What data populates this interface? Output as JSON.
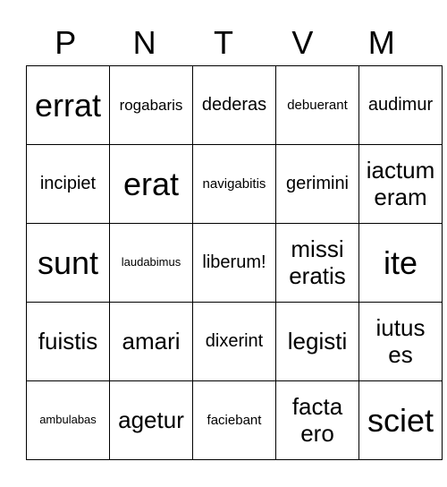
{
  "header": [
    "P",
    "N",
    "T",
    "V",
    "M"
  ],
  "rows": [
    [
      "errat",
      "rogabaris",
      "dederas",
      "debuerant",
      "audimur"
    ],
    [
      "incipiet",
      "erat",
      "navigabitis",
      "gerimini",
      "iactum eram"
    ],
    [
      "sunt",
      "laudabimus",
      "liberum!",
      "missi eratis",
      "ite"
    ],
    [
      "fuistis",
      "amari",
      "dixerint",
      "legisti",
      "iutus es"
    ],
    [
      "ambulabas",
      "agetur",
      "faciebant",
      "facta ero",
      "sciet"
    ]
  ]
}
